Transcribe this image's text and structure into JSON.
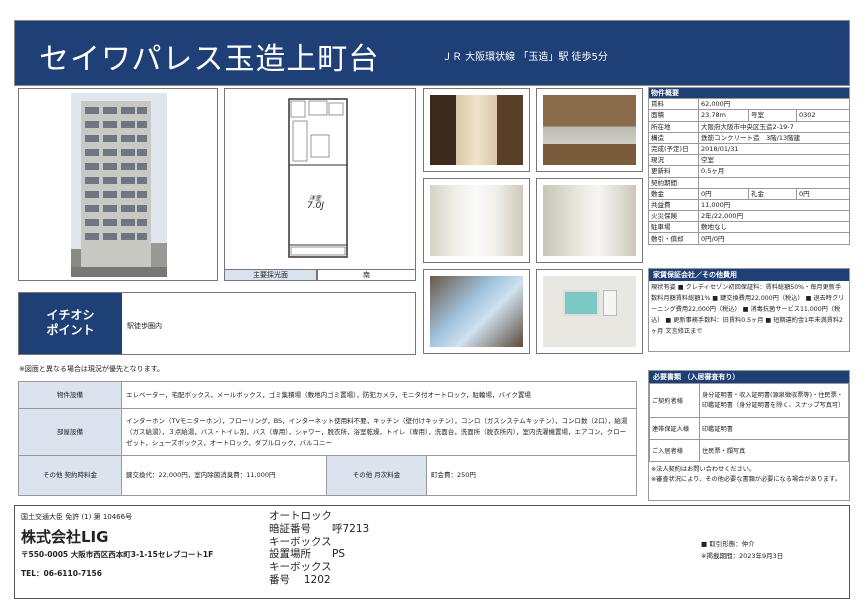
{
  "header": {
    "title": "セイワパレス玉造上町台",
    "subtitle": "ＪＲ 大阪環状線 「玉造」駅 徒歩5分"
  },
  "captions": {
    "floorplan_orientation": "主要採光面",
    "floorplan_direction": "南"
  },
  "floorplan": {
    "room_label": "洋室",
    "room_size": "7.0J"
  },
  "highlight": {
    "label_line1": "イチオシ",
    "label_line2": "ポイント",
    "text": "駅徒歩圏内"
  },
  "note": "※図面と異なる場合は現況が優先となります。",
  "spec": {
    "section_title": "物件概要",
    "rows": [
      {
        "label": "賃料",
        "value": "62,000円"
      },
      {
        "label": "面積",
        "value": "23.78m",
        "label2": "号室",
        "value2": "0302"
      },
      {
        "label": "所在地",
        "value": "大阪府大阪市中央区玉造2-19-7"
      },
      {
        "label": "構造",
        "value": "鉄筋コンクリート造　3階/13階建"
      },
      {
        "label": "完成(予定)日",
        "value": "2018/01/31"
      },
      {
        "label": "現況",
        "value": "空室"
      },
      {
        "label": "更新料",
        "value": "0.5ヶ月"
      },
      {
        "label": "契約期間",
        "value": ""
      },
      {
        "label": "敷金",
        "value": "0円",
        "label2": "礼金",
        "value2": "0円"
      },
      {
        "label": "共益費",
        "value": "11,000円"
      },
      {
        "label": "火災保険",
        "value": "2年/22,000円"
      },
      {
        "label": "駐車場",
        "value": "敷地なし"
      },
      {
        "label": "敷引・償却",
        "value": "0円/0円"
      }
    ],
    "guarantee_title": "家賃保証会社／その他費用",
    "guarantee_text": "現状有姿 ■ クレディセゾン初回保証料：賃料総額50%・毎月更新手数料月額賃料総額1% ■ 鍵交換費用22,000円（税込） ■ 退去時クリーニング費用22,000円（税込） ■ 消毒抗菌サービス11,000円（税込） ■ 更新事務手数料：旧賃料0.5ヶ月 ■ 短期違約金1年未満賃料2ヶ月 文言修正まで",
    "docs_title": "必要書類 （入居審査有り）",
    "docs": [
      {
        "label": "ご契約者様",
        "value": "身分証明書・収入証明書(源泉徴収票等)・住民票・印鑑証明書（身分証明書を除く、スナップ写真可）"
      },
      {
        "label": "連帯保証人様",
        "value": "印鑑証明書"
      },
      {
        "label": "ご入居者様",
        "value": "住民票・顔写真"
      }
    ],
    "docs_note": "※法人契約はお問い合わせください。\n※審査状況により、その他必要な書類が必要になる場合があります。"
  },
  "facilities": [
    {
      "label": "物件設備",
      "value": "エレベーター，宅配ボックス，メールボックス，ゴミ集積場（敷地内ゴミ置場），防犯カメラ，モニタ付オートロック，駐輪場，バイク置場"
    },
    {
      "label": "部屋設備",
      "value": "インターホン（TVモニターホン），フローリング，BS，インターネット使用料不要，キッチン（壁付けキッチン），コンロ（ガスシステムキッチン），コンロ数（2口），給湯（ガス給湯），３点給湯，バス・トイレ別，バス（専用），シャワー，脱衣所，浴室乾燥，トイレ（専用），洗面台，洗面所（脱衣所内），室内洗濯機置場，エアコン，クローゼット，シューズボックス，オートロック，ダブルロック，バルコニー"
    }
  ],
  "other_fees": {
    "label": "その他 契約時料金",
    "value": "鍵交換代：22,000円，室内除菌消臭費：11,000円",
    "label2": "その他 月次料金",
    "value2": "町会費：250円"
  },
  "footer": {
    "license": "国土交通大臣 免許 (1) 第 10466号",
    "company": "株式会社LIG",
    "address": "〒550-0005 大阪市西区西本町3-1-15セレブコート1F",
    "tel": "TEL：06-6110-7156",
    "memo": [
      "オートロック",
      "暗証番号　　呼7213",
      "キーボックス",
      "設置場所　　PS",
      "キーボックス",
      "番号　 1202"
    ],
    "deal": "■ 取引形態：仲介",
    "date": "※掲載期間：2023年9月3日"
  }
}
